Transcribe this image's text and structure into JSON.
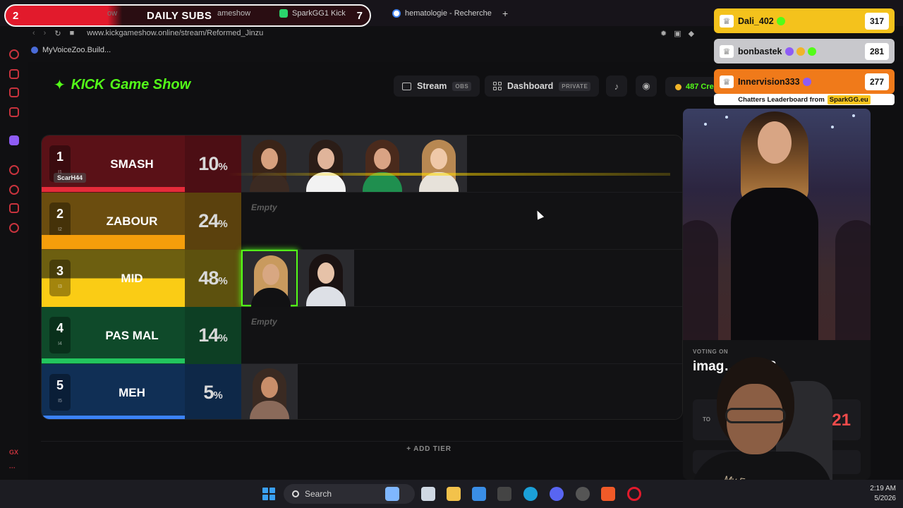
{
  "browser": {
    "subs_banner": {
      "left_count": "2",
      "title": "DAILY SUBS",
      "right_count": "7"
    },
    "tabs": [
      {
        "label": "ow"
      },
      {
        "label": "ameshow"
      },
      {
        "label": "SparkGG1 Kick"
      },
      {
        "label": "hematologie - Recherche"
      }
    ],
    "new_tab": "+",
    "url": "www.kickgameshow.online/stream/Reformed_Jinzu",
    "bookmark": "MyVoiceZoo.Build..."
  },
  "sidebar": {
    "icons": [
      "speed-icon",
      "aria-icon",
      "pen-icon",
      "mail-icon",
      "twitch-icon",
      "player-icon",
      "history-icon",
      "extensions-icon",
      "settings-icon"
    ],
    "gx_label": "GX",
    "more_label": "···"
  },
  "header": {
    "logo_kick": "KICK",
    "logo_rest": "Game Show",
    "stream_label": "Stream",
    "stream_tag": "OBS",
    "dashboard_label": "Dashboard",
    "dashboard_tag": "PRIVATE",
    "credits_label": "487 Cre"
  },
  "tiers": [
    {
      "rank": "1",
      "sub": "I1",
      "label": "SMASH",
      "percent": "10",
      "color": "#e52b3a",
      "bg": "#5a1117",
      "images": 4,
      "empty": false
    },
    {
      "rank": "2",
      "sub": "I2",
      "label": "ZABOUR",
      "percent": "24",
      "color": "#f59e0b",
      "bg": "#6b4d0f",
      "images": 0,
      "empty": true
    },
    {
      "rank": "3",
      "sub": "I3",
      "label": "MID",
      "percent": "48",
      "color": "#facc15",
      "bg": "#6d5f10",
      "images": 2,
      "empty": false
    },
    {
      "rank": "4",
      "sub": "I4",
      "label": "PAS MAL",
      "percent": "14",
      "color": "#22c55e",
      "bg": "#0f4a2a",
      "images": 0,
      "empty": true
    },
    {
      "rank": "5",
      "sub": "I5",
      "label": "MEH",
      "percent": "5",
      "color": "#3b82f6",
      "bg": "#102f55",
      "images": 1,
      "empty": false
    }
  ],
  "empty_text": "Empty",
  "percent_sign": "%",
  "drag_user": "ScarH44",
  "add_tier_label": "+ ADD TIER",
  "voting": {
    "label": "VOTING ON",
    "title": "imag…-04-23_",
    "total_label": "TO",
    "total_value": "21"
  },
  "webcam": {
    "shirt_text": "My Favorous Is A"
  },
  "leaderboard": {
    "rows": [
      {
        "name": "Dali_402",
        "score": "317",
        "bg": "#f4c21c"
      },
      {
        "name": "bonbastek",
        "score": "281",
        "bg": "#c8c8cc"
      },
      {
        "name": "Innervision333",
        "score": "277",
        "bg": "#f07a1a"
      }
    ],
    "footer_text": "Chatters Leaderboard from",
    "footer_brand": "SparkGG.eu"
  },
  "taskbar": {
    "search_label": "Search",
    "time": "2:19 AM",
    "date": "5/2026"
  },
  "colors": {
    "kick_green": "#53fc18",
    "accent_red": "#e21a2c"
  }
}
